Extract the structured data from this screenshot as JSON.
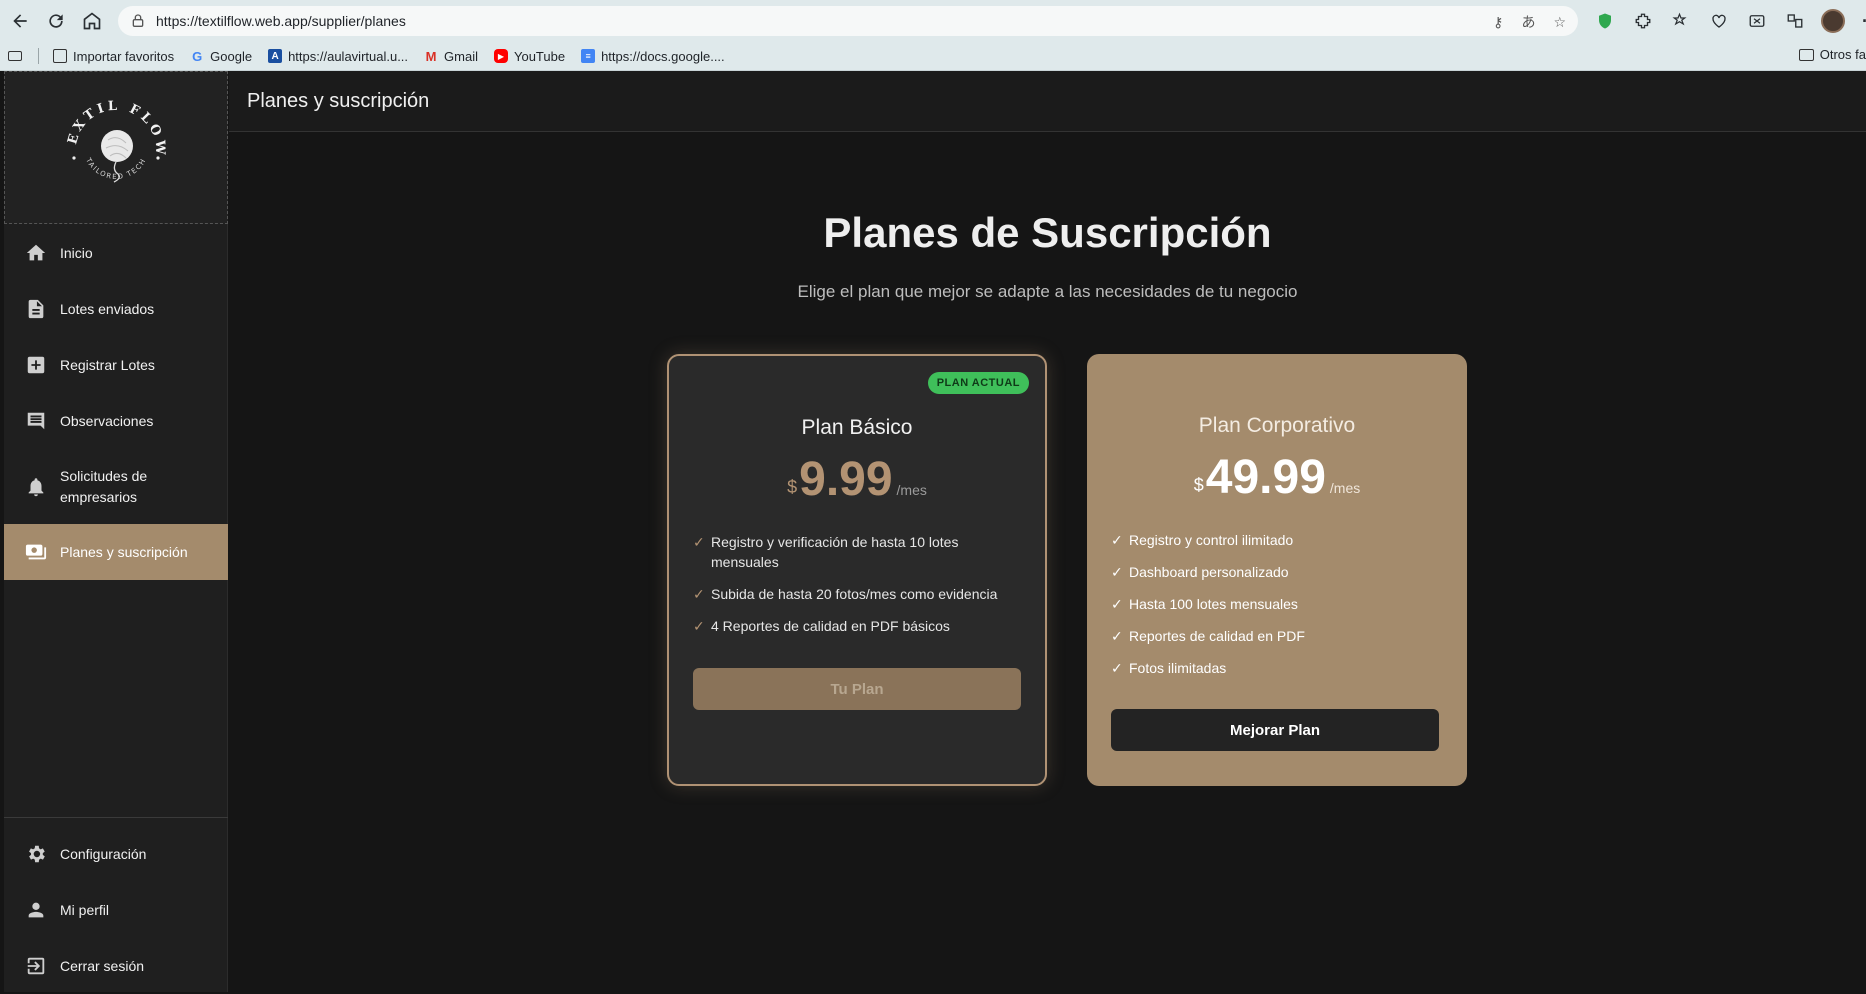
{
  "browser": {
    "url": "https://textilflow.web.app/supplier/planes",
    "bookmarks": [
      {
        "label": "Importar favoritos",
        "icon": "folder-import-icon"
      },
      {
        "label": "Google",
        "icon": "google-icon"
      },
      {
        "label": "https://aulavirtual.u...",
        "icon": "aulavirtual-icon"
      },
      {
        "label": "Gmail",
        "icon": "gmail-icon"
      },
      {
        "label": "YouTube",
        "icon": "youtube-icon"
      },
      {
        "label": "https://docs.google....",
        "icon": "google-docs-icon"
      }
    ],
    "other_bookmarks": "Otros fa"
  },
  "logo": {
    "brand": "TEXTIL FLOW",
    "tagline": "TAILORED TECH"
  },
  "sidebar": {
    "items": [
      {
        "label": "Inicio",
        "icon": "home-icon"
      },
      {
        "label": "Lotes enviados",
        "icon": "document-icon"
      },
      {
        "label": "Registrar Lotes",
        "icon": "add-box-icon"
      },
      {
        "label": "Observaciones",
        "icon": "comment-icon"
      },
      {
        "label": "Solicitudes de empresarios",
        "icon": "bell-icon"
      },
      {
        "label": "Planes y suscripción",
        "icon": "payments-icon",
        "active": true
      }
    ],
    "bottom_items": [
      {
        "label": "Configuración",
        "icon": "gear-icon"
      },
      {
        "label": "Mi perfil",
        "icon": "person-icon"
      },
      {
        "label": "Cerrar sesión",
        "icon": "logout-icon"
      }
    ]
  },
  "header": {
    "title": "Planes y suscripción"
  },
  "main": {
    "title": "Planes de Suscripción",
    "subtitle": "Elige el plan que mejor se adapte a las necesidades de tu negocio"
  },
  "plans": [
    {
      "name": "Plan Básico",
      "badge": "PLAN ACTUAL",
      "currency": "$",
      "price": "9.99",
      "period": "/mes",
      "features": [
        "Registro y verificación de hasta 10 lotes mensuales",
        "Subida de hasta 20 fotos/mes como evidencia",
        "4 Reportes de calidad en PDF básicos"
      ],
      "button": "Tu Plan"
    },
    {
      "name": "Plan Corporativo",
      "currency": "$",
      "price": "49.99",
      "period": "/mes",
      "features": [
        "Registro y control ilimitado",
        "Dashboard personalizado",
        "Hasta 100 lotes mensuales",
        "Reportes de calidad en PDF",
        "Fotos ilimitadas"
      ],
      "button": "Mejorar Plan"
    }
  ],
  "colors": {
    "accent": "#a48b6c",
    "badge_green": "#3fbf5a",
    "background": "#151515",
    "sidebar": "#1f1f1f"
  }
}
